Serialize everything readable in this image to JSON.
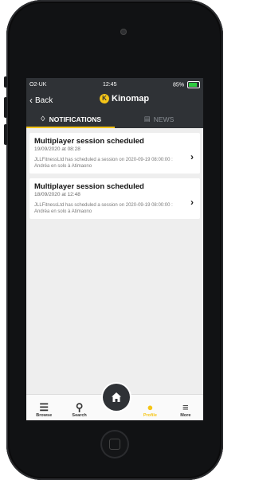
{
  "status": {
    "carrier": "O2-UK",
    "time": "12:45",
    "battery": "85%",
    "battery_level": 0.85
  },
  "nav": {
    "back_label": "Back",
    "brand": "Kinomap"
  },
  "tabs": [
    {
      "label": "NOTIFICATIONS",
      "icon": "bell-icon",
      "active": true
    },
    {
      "label": "NEWS",
      "icon": "news-icon",
      "active": false
    }
  ],
  "notifications": [
    {
      "title": "Multiplayer session scheduled",
      "date": "19/09/2020 at 08:28",
      "desc": "JLLFitnessLtd has scheduled a session on 2020-09-19 08:00:00 : Andréa en solo à Atimaono"
    },
    {
      "title": "Multiplayer session scheduled",
      "date": "18/09/2020 at 12:48",
      "desc": "JLLFitnessLtd has scheduled a session on 2020-09-19 08:00:00 : Andréa en solo à Atimaono"
    }
  ],
  "tabbar": [
    {
      "label": "Browse",
      "icon": "tray-icon"
    },
    {
      "label": "Search",
      "icon": "search-icon"
    },
    {
      "label": "",
      "icon": "home-icon"
    },
    {
      "label": "Profile",
      "icon": "profile-icon",
      "active": true
    },
    {
      "label": "More",
      "icon": "menu-icon"
    }
  ],
  "colors": {
    "accent": "#f5c518",
    "header": "#2f3236",
    "background": "#eeeeee"
  }
}
